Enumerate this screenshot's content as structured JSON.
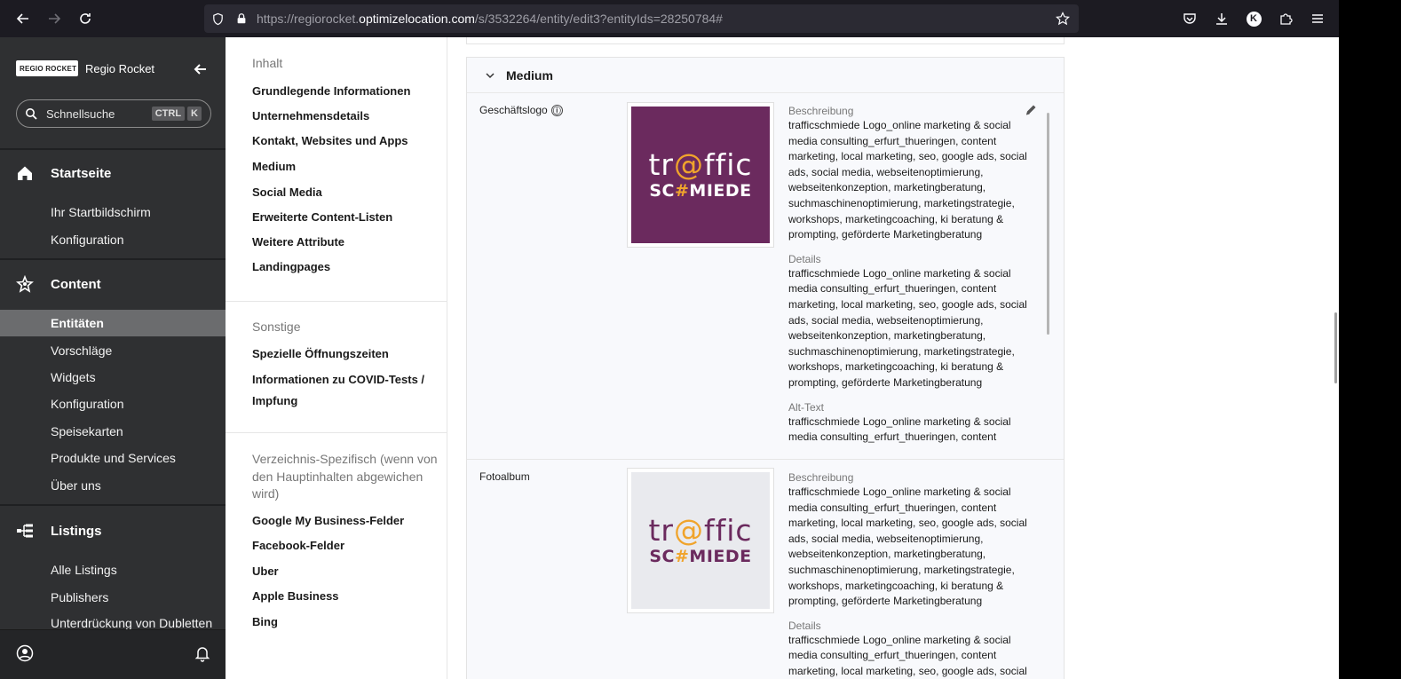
{
  "browser": {
    "url_prefix": "https://regiorocket.",
    "url_domain": "optimizelocation.com",
    "url_suffix": "/s/3532264/entity/edit3?entityIds=28250784#",
    "profile_initial": "K"
  },
  "sidebar": {
    "brand_logo_text": "REGIO ROCKET",
    "brand_name": "Regio Rocket",
    "search_placeholder": "Schnellsuche",
    "shortcut_keys": [
      "CTRL",
      "K"
    ],
    "sections": [
      {
        "title": "Startseite",
        "icon": "home-icon",
        "items": [
          "Ihr Startbildschirm",
          "Konfiguration"
        ]
      },
      {
        "title": "Content",
        "icon": "content-icon",
        "items": [
          "Entitäten",
          "Vorschläge",
          "Widgets",
          "Konfiguration",
          "Speisekarten",
          "Produkte und Services",
          "Über uns"
        ],
        "active_index": 0
      },
      {
        "title": "Listings",
        "icon": "listings-icon",
        "items": [
          "Alle Listings",
          "Publishers",
          "Unterdrückung von Dubletten"
        ]
      }
    ]
  },
  "toc": {
    "groups": [
      {
        "label": "Inhalt",
        "items": [
          "Grundlegende Informationen",
          "Unternehmensdetails",
          "Kontakt, Websites und Apps",
          "Medium",
          "Social Media",
          "Erweiterte Content-Listen",
          "Weitere Attribute",
          "Landingpages"
        ]
      },
      {
        "label": "Sonstige",
        "items": [
          "Spezielle Öffnungszeiten",
          "Informationen zu COVID-Tests /",
          "Impfung"
        ]
      },
      {
        "label_lines": [
          "Verzeichnis-Spezifisch (wenn von",
          "den Hauptinhalten abgewichen",
          "wird)"
        ],
        "items": [
          "Google My Business-Felder",
          "Facebook-Felder",
          "Uber",
          "Apple Business",
          "Bing"
        ]
      }
    ]
  },
  "section": {
    "title": "Medium",
    "fields": [
      {
        "label": "Geschäftslogo",
        "info_icon": "ⓘ",
        "logo_line1_a": "tr",
        "logo_line1_at": "@",
        "logo_line1_b": "ffic",
        "logo_line2_a": "SC",
        "logo_line2_hash": "#",
        "logo_line2_b": "MIEDE",
        "bg_color": "#6b2a5e",
        "text_color": "#ffffff",
        "desc_label": "Beschreibung",
        "desc_lines": [
          "trafficschmiede Logo_online marketing & social",
          "media consulting_erfurt_thueringen,  content",
          "marketing, local marketing, seo, google ads, social",
          "ads, social media, webseitenoptimierung,",
          "webseitenkonzeption, marketingberatung,",
          "suchmaschinenoptimierung, marketingstrategie,",
          "workshops, marketingcoaching, ki beratung &",
          "prompting, geförderte Marketingberatung"
        ],
        "details_label": "Details",
        "details_lines": [
          "trafficschmiede Logo_online marketing & social",
          "media consulting_erfurt_thueringen,  content",
          "marketing, local marketing, seo, google ads, social",
          "ads, social media, webseitenoptimierung,",
          "webseitenkonzeption, marketingberatung,",
          "suchmaschinenoptimierung, marketingstrategie,",
          "workshops, marketingcoaching, ki beratung &",
          "prompting, geförderte Marketingberatung"
        ],
        "alt_label": "Alt-Text",
        "alt_lines": [
          "trafficschmiede Logo_online marketing & social",
          "media consulting_erfurt_thueringen,  content"
        ]
      },
      {
        "label": "Fotoalbum",
        "logo_line1_a": "tr",
        "logo_line1_at": "@",
        "logo_line1_b": "ffic",
        "logo_line2_a": "SC",
        "logo_line2_hash": "#",
        "logo_line2_b": "MIEDE",
        "bg_color": "#e9eaee",
        "text_color": "#6b2a5e",
        "desc_label": "Beschreibung",
        "desc_lines": [
          "trafficschmiede Logo_online marketing & social",
          "media consulting_erfurt_thueringen,  content",
          "marketing, local marketing, seo, google ads, social",
          "ads, social media, webseitenoptimierung,",
          "webseitenkonzeption, marketingberatung,",
          "suchmaschinenoptimierung, marketingstrategie,",
          "workshops, marketingcoaching, ki beratung &",
          "prompting, geförderte Marketingberatung"
        ],
        "details_label": "Details",
        "details_lines": [
          "trafficschmiede Logo_online marketing & social",
          "media consulting_erfurt_thueringen,  content",
          "marketing, local marketing, seo, google ads, social"
        ]
      }
    ]
  }
}
